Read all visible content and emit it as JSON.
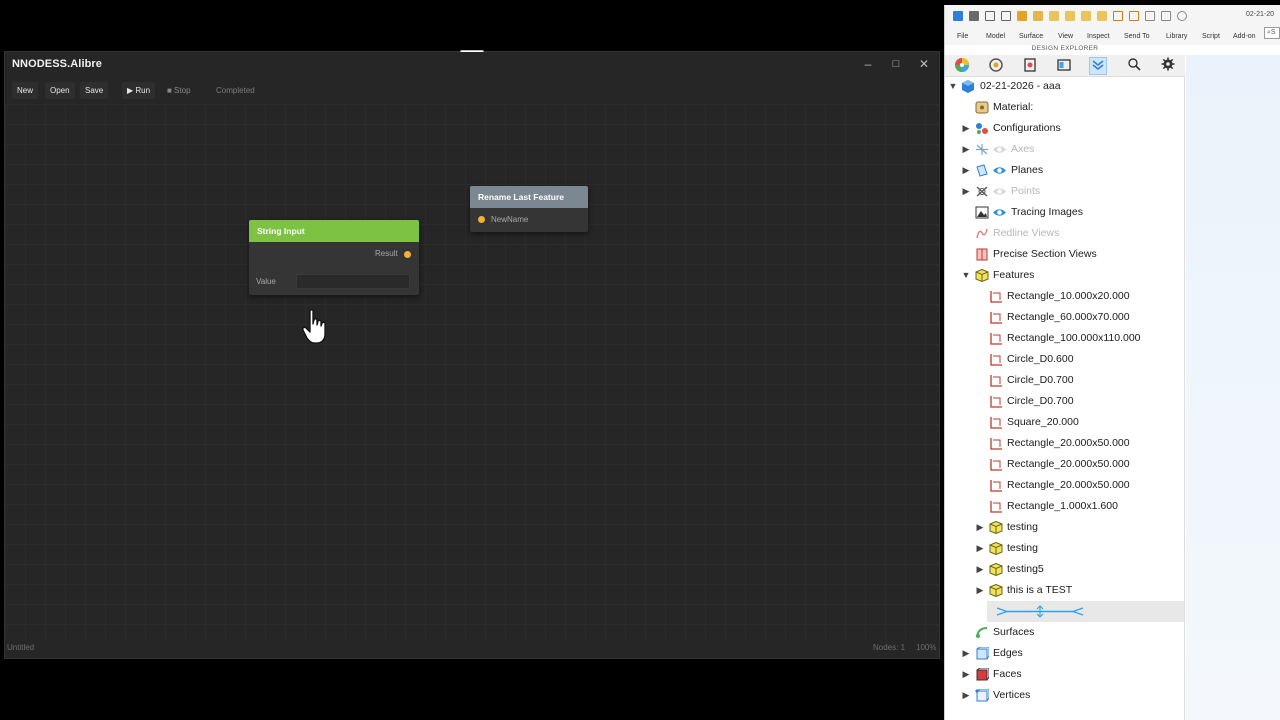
{
  "nnodess": {
    "title": "NNODESS.Alibre",
    "window_buttons": {
      "minimize": "–",
      "maximize": "□",
      "close": "✕"
    },
    "toolbar": {
      "new": "New",
      "open": "Open",
      "save": "Save",
      "run": "▶ Run",
      "stop": "■ Stop",
      "status": "Completed"
    },
    "nodes": {
      "rename": {
        "title": "Rename Last Feature",
        "input_port": "NewName",
        "header_color": "#7b8791"
      },
      "string_input": {
        "title": "String Input",
        "output_port": "Result",
        "field_label": "Value",
        "field_value": "",
        "header_color": "#7dc242"
      }
    },
    "statusbar": {
      "document": "Untitled",
      "nodes": "Nodes: 1",
      "zoom": "100%"
    }
  },
  "alibre": {
    "date_short": "02-21-20",
    "menu": [
      "File",
      "Model",
      "Surface",
      "View",
      "Inspect",
      "Send To",
      "Library",
      "Script",
      "Add-on"
    ],
    "search_hint": "S",
    "design_explorer_title": "DESIGN EXPLORER",
    "tree": {
      "root": "02-21-2026 - aaa",
      "material": "Material:",
      "configurations": "Configurations",
      "axes": "Axes",
      "planes": "Planes",
      "points": "Points",
      "tracing_images": "Tracing Images",
      "redline_views": "Redline Views",
      "precise_section_views": "Precise Section Views",
      "features": "Features",
      "feature_items": [
        "Rectangle_10.000x20.000",
        "Rectangle_60.000x70.000",
        "Rectangle_100.000x110.000",
        "Circle_D0.600",
        "Circle_D0.700",
        "Circle_D0.700",
        "Square_20.000",
        "Rectangle_20.000x50.000",
        "Rectangle_20.000x50.000",
        "Rectangle_20.000x50.000",
        "Rectangle_1.000x1.600"
      ],
      "folders": [
        "testing",
        "testing",
        "testing5",
        "this is a TEST"
      ],
      "surfaces": "Surfaces",
      "edges": "Edges",
      "faces": "Faces",
      "vertices": "Vertices"
    }
  }
}
